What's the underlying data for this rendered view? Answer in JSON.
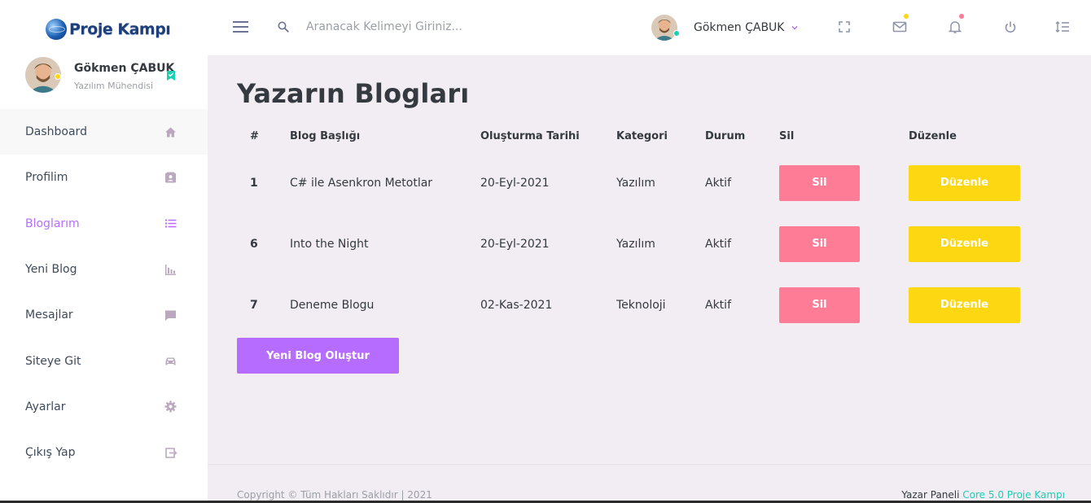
{
  "brand": {
    "name": "Proje Kampı"
  },
  "topbar": {
    "search_placeholder": "Aranacak Kelimeyi Giriniz...",
    "user_name": "Gökmen ÇABUK",
    "icons": [
      "menu-icon",
      "search-icon",
      "fullscreen-icon",
      "mail-icon",
      "bell-icon",
      "power-icon",
      "list-settings-icon"
    ],
    "mail_badge_color": "#fed713",
    "bell_badge_color": "#fe7c96"
  },
  "sidebar": {
    "profile": {
      "name": "Gökmen ÇABUK",
      "role": "Yazılım Mühendisi"
    },
    "items": [
      {
        "label": "Dashboard",
        "icon": "home-icon"
      },
      {
        "label": "Profilim",
        "icon": "contact-card-icon"
      },
      {
        "label": "Bloglarım",
        "icon": "list-icon",
        "active": true
      },
      {
        "label": "Yeni Blog",
        "icon": "bar-chart-icon"
      },
      {
        "label": "Mesajlar",
        "icon": "message-icon"
      },
      {
        "label": "Siteye Git",
        "icon": "car-icon"
      },
      {
        "label": "Ayarlar",
        "icon": "gear-icon"
      },
      {
        "label": "Çıkış Yap",
        "icon": "logout-icon"
      }
    ]
  },
  "main": {
    "title": "Yazarın Blogları",
    "columns": [
      "#",
      "Blog Başlığı",
      "Oluşturma Tarihi",
      "Kategori",
      "Durum",
      "Sil",
      "Düzenle"
    ],
    "rows": [
      {
        "id": "1",
        "title": "C# ile Asenkron Metotlar",
        "date": "20-Eyl-2021",
        "category": "Yazılım",
        "status": "Aktif",
        "delete_label": "Sil",
        "edit_label": "Düzenle"
      },
      {
        "id": "6",
        "title": "Into the Night",
        "date": "20-Eyl-2021",
        "category": "Yazılım",
        "status": "Aktif",
        "delete_label": "Sil",
        "edit_label": "Düzenle"
      },
      {
        "id": "7",
        "title": "Deneme Blogu",
        "date": "02-Kas-2021",
        "category": "Teknoloji",
        "status": "Aktif",
        "delete_label": "Sil",
        "edit_label": "Düzenle"
      }
    ],
    "new_button": "Yeni Blog Oluştur"
  },
  "footer": {
    "copyright": "Copyright © Tüm Hakları Saklıdır | 2021",
    "panel_text": "Yazar Paneli",
    "panel_link": "Core 5.0 Proje Kampı"
  },
  "colors": {
    "accent": "#b66dff",
    "danger": "#fe7c96",
    "warning": "#fed713",
    "success": "#1bcfb4",
    "background": "#f2edf3"
  }
}
